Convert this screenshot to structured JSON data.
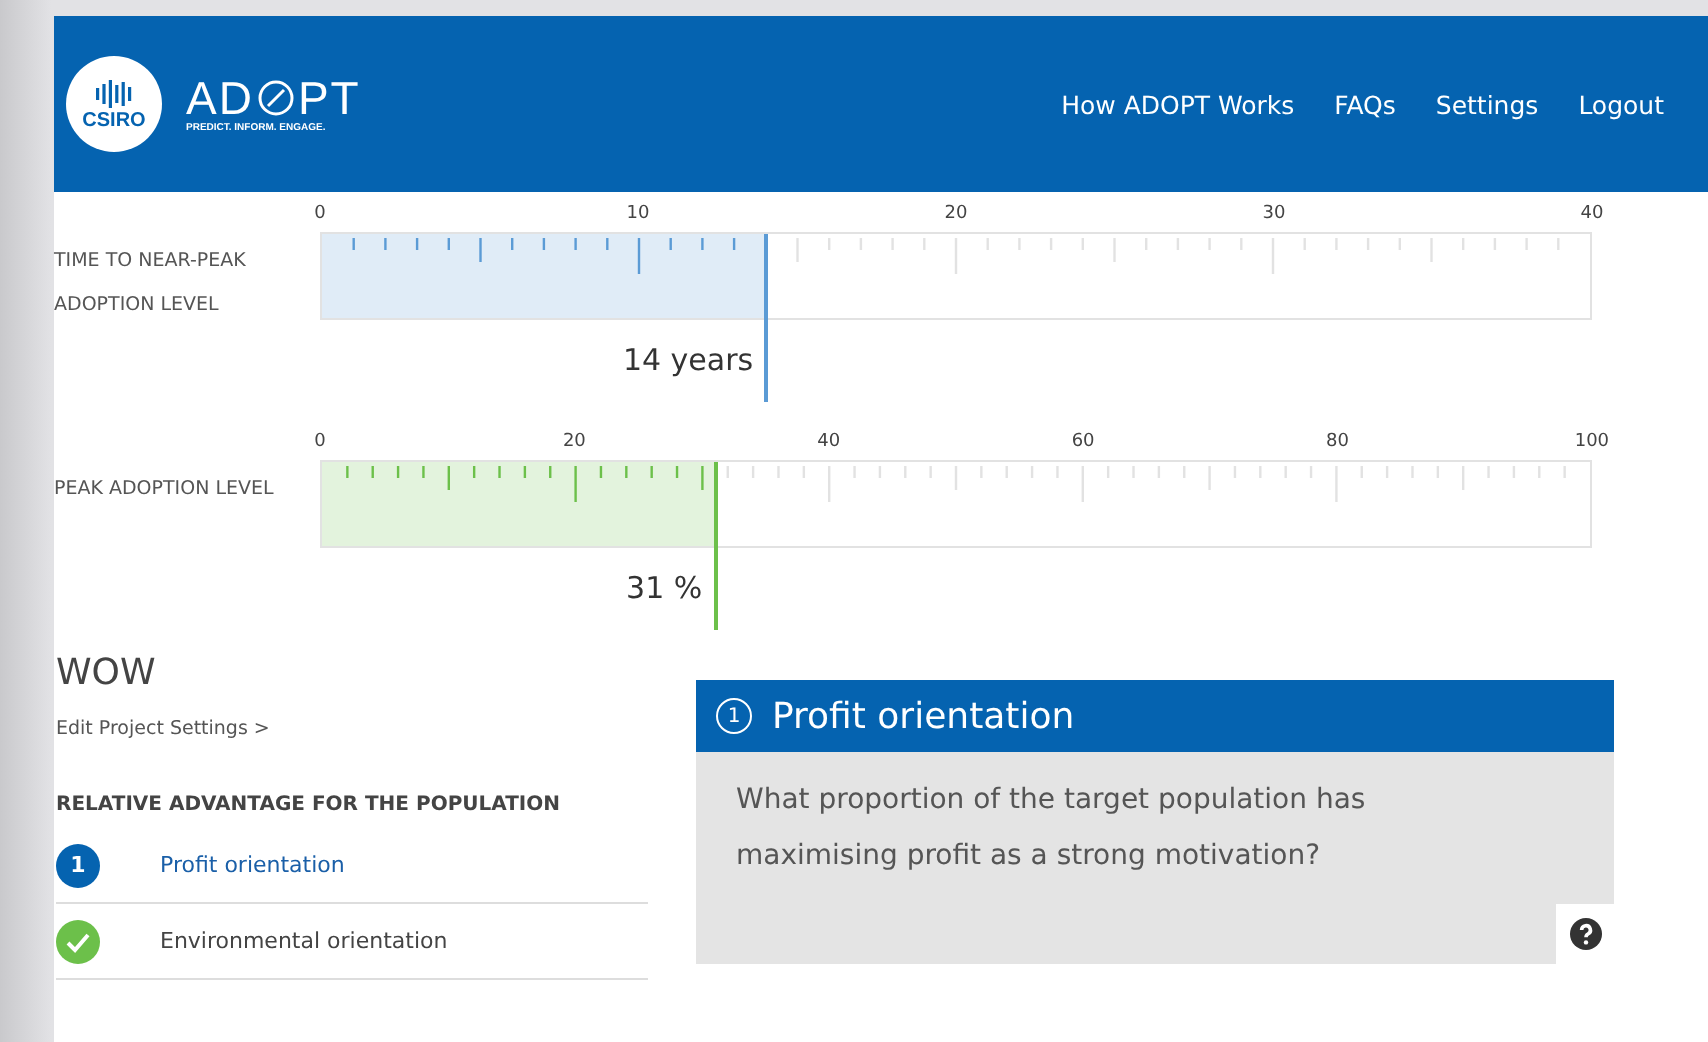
{
  "header": {
    "logo": {
      "brand": "CSIRO",
      "product": "AD",
      "product_tail": "PT",
      "tagline": "PREDICT. INFORM. ENGAGE."
    },
    "nav": [
      "How ADOPT Works",
      "FAQs",
      "Settings",
      "Logout"
    ]
  },
  "meters": [
    {
      "label": "TIME TO NEAR-PEAK ADOPTION LEVEL",
      "scale": [
        "0",
        "10",
        "20",
        "30",
        "40"
      ],
      "level": 0.35,
      "reading": "14 years",
      "color": "#5b9bd5"
    },
    {
      "label": "PEAK ADOPTION LEVEL",
      "scale": [
        "0",
        "20",
        "40",
        "60",
        "80",
        "100"
      ],
      "level": 0.31,
      "reading": "31 %",
      "color": "#6cc04a"
    }
  ],
  "project": {
    "name": "WOW",
    "edit_link": "Edit Project Settings >"
  },
  "section": {
    "title": "RELATIVE ADVANTAGE FOR THE POPULATION",
    "items": [
      {
        "kind": "current",
        "number": "1",
        "label": "Profit orientation",
        "selected": true
      },
      {
        "kind": "done",
        "label": "Environmental orientation",
        "selected": false
      }
    ]
  },
  "question": {
    "number": "1",
    "title": "Profit orientation",
    "text": "What proportion of the target population has maximising profit as a strong motivation?"
  }
}
